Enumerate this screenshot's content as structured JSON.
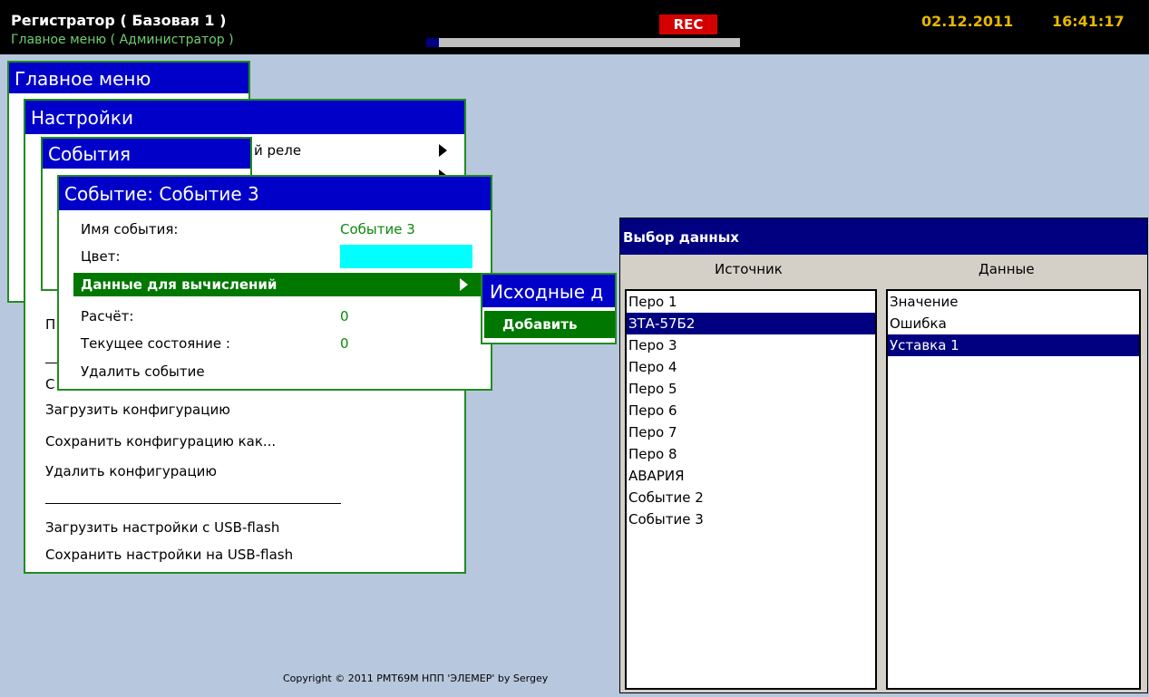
{
  "topbar": {
    "title": "Регистратор ( Базовая 1 )",
    "subtitle": "Главное меню ( Администратор )",
    "rec": "REC",
    "progress": 0.04,
    "date": "02.12.2011",
    "time": "16:41:17"
  },
  "main_menu": {
    "title": "Главное меню"
  },
  "settings_menu": {
    "title": "Настройки",
    "items": {
      "relay": "й реле",
      "partial_1": "П",
      "partial_2": "С",
      "load_config": "Загрузить конфигурацию",
      "save_config_as": "Сохранить конфигурацию как...",
      "delete_config": "Удалить конфигурацию",
      "load_usb": "Загрузить настройки с USB-flash",
      "save_usb": "Сохранить настройки на USB-flash"
    }
  },
  "events_menu": {
    "title": "События"
  },
  "event_window": {
    "title": "Событие: Событие 3",
    "name_label": "Имя события:",
    "name_value": "Событие 3",
    "color_label": "Цвет:",
    "color_value": "#00ffff",
    "calc_data_label": "Данные для вычислений",
    "calculation_label": "Расчёт:",
    "calculation_value": "0",
    "state_label": "Текущее состояние :",
    "state_value": "0",
    "delete_label": "Удалить событие"
  },
  "source_data_popup": {
    "title": "Исходные д",
    "add_label": "Добавить"
  },
  "data_dialog": {
    "title": "Выбор данных",
    "source_header": "Источник",
    "data_header": "Данные",
    "sources": [
      "Перо 1",
      "ЗТА-57Б2",
      "Перо 3",
      "Перо 4",
      "Перо 5",
      "Перо 6",
      "Перо 7",
      "Перо 8",
      "АВАРИЯ",
      "Событие 2",
      "Событие 3"
    ],
    "selected_source": 1,
    "data_items": [
      "Значение",
      "Ошибка",
      "Уставка 1"
    ],
    "selected_data": 2
  },
  "copyright": "Copyright © 2011 РМТ69М НПП 'ЭЛЕМЕР' by Sergey",
  "colors": {
    "title_blue": "#0000c8",
    "selection_green": "#007800",
    "selection_navy": "#000080",
    "border_green": "#228b22",
    "value_green": "#0a8a0a",
    "date_yellow": "#e6b800"
  }
}
